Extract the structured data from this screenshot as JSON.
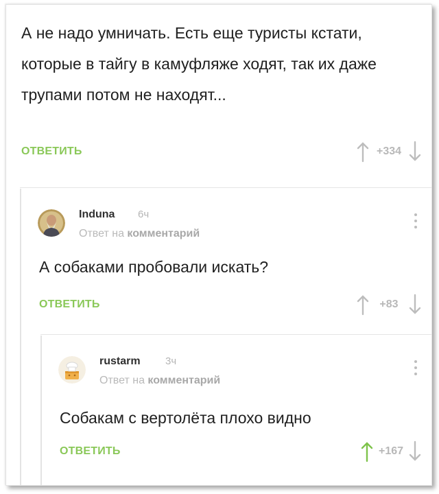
{
  "comments": [
    {
      "text": "А не надо умничать. Есть еще туристы кстати, которые в тайгу в камуфляже ходят, так их даже трупами потом не находят...",
      "reply_label": "ОТВЕТИТЬ",
      "score": "+334",
      "upvoted": false
    },
    {
      "username": "Induna",
      "time": "6ч",
      "reply_to_prefix": "Ответ на",
      "reply_to_link": "комментарий",
      "text": "А собаками пробовали искать?",
      "reply_label": "ОТВЕТИТЬ",
      "score": "+83",
      "upvoted": false
    },
    {
      "username": "rustarm",
      "time": "3ч",
      "reply_to_prefix": "Ответ на",
      "reply_to_link": "комментарий",
      "text": "Собакам с вертолёта плохо видно",
      "reply_label": "ОТВЕТИТЬ",
      "score": "+167",
      "upvoted": true
    }
  ],
  "colors": {
    "accent_green": "#8ac858",
    "muted_grey": "#b8b8b8",
    "text": "#1f1f1f"
  },
  "icons": {
    "upvote": "arrow-up-icon",
    "downvote": "arrow-down-icon",
    "menu": "more-vertical-icon"
  }
}
